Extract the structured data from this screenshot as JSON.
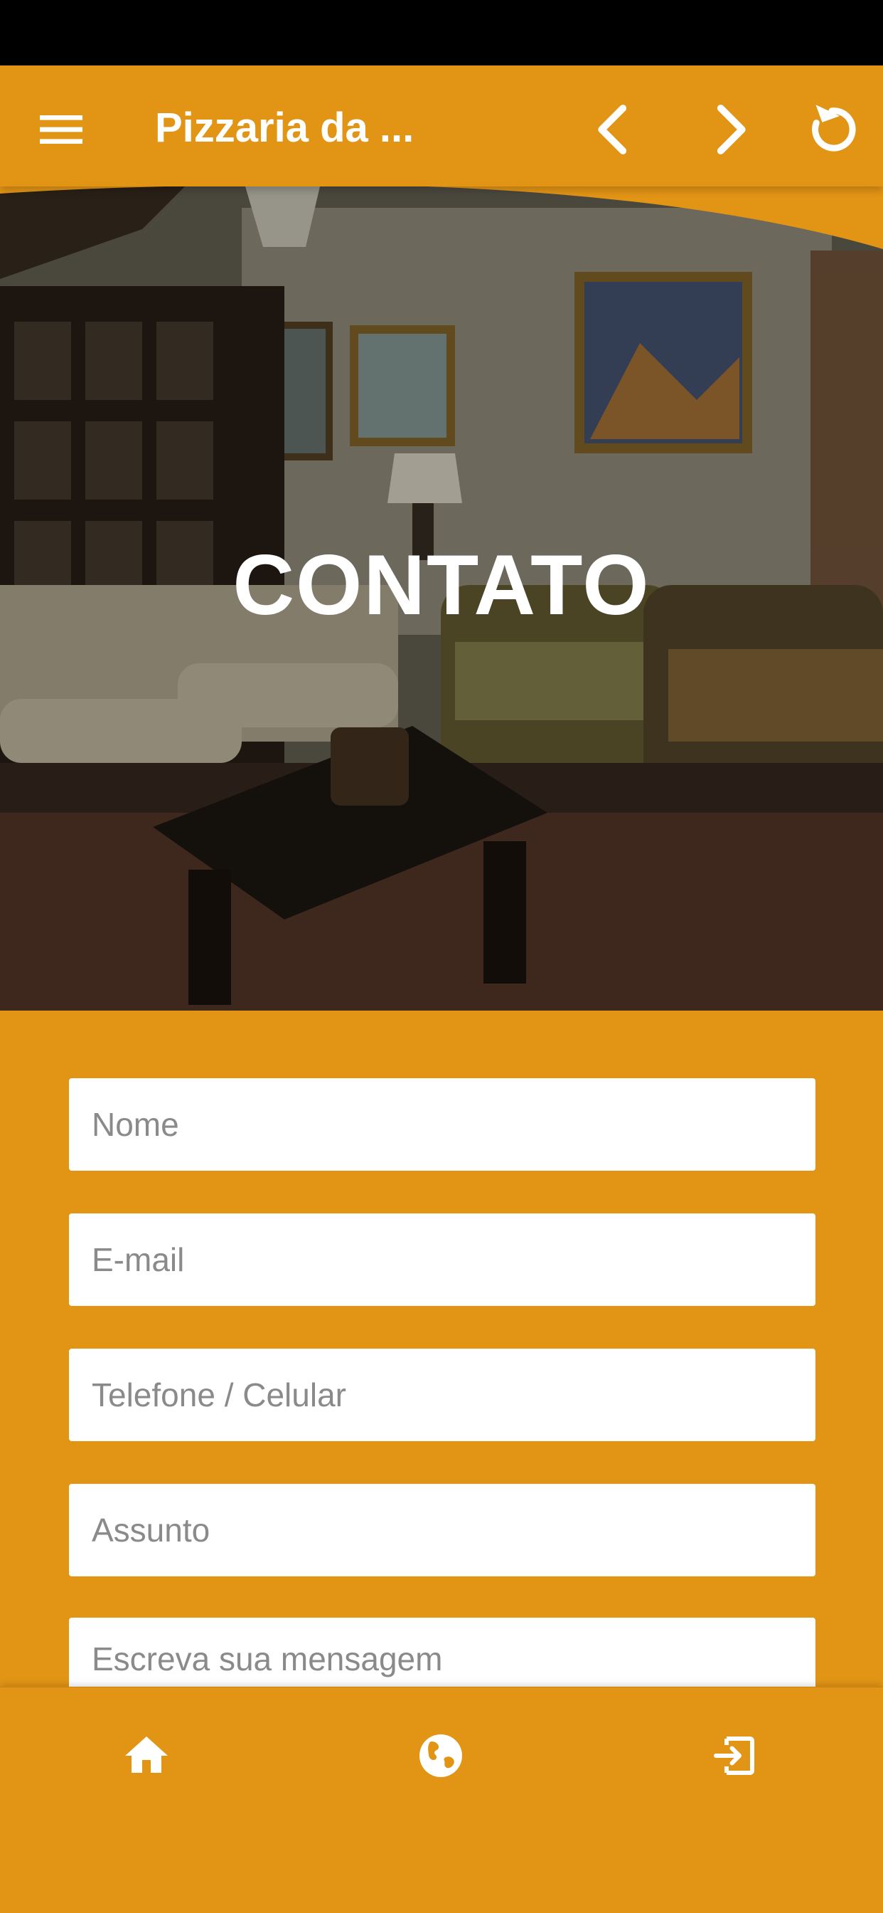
{
  "app_bar": {
    "title": "Pizzaria da ...",
    "menu_icon": "menu-icon",
    "back_icon": "chevron-left-icon",
    "forward_icon": "chevron-right-icon",
    "reload_icon": "reload-icon"
  },
  "hero": {
    "heading": "CONTATO"
  },
  "form": {
    "name_placeholder": "Nome",
    "email_placeholder": "E-mail",
    "phone_placeholder": "Telefone / Celular",
    "subject_placeholder": "Assunto",
    "message_placeholder": "Escreva sua mensagem"
  },
  "bottom_nav": {
    "items": [
      {
        "icon": "home-icon"
      },
      {
        "icon": "globe-icon"
      },
      {
        "icon": "exit-icon"
      }
    ]
  },
  "colors": {
    "accent": "#E29415",
    "text_on_accent": "#FFFFFF",
    "status_bar": "#000000"
  }
}
